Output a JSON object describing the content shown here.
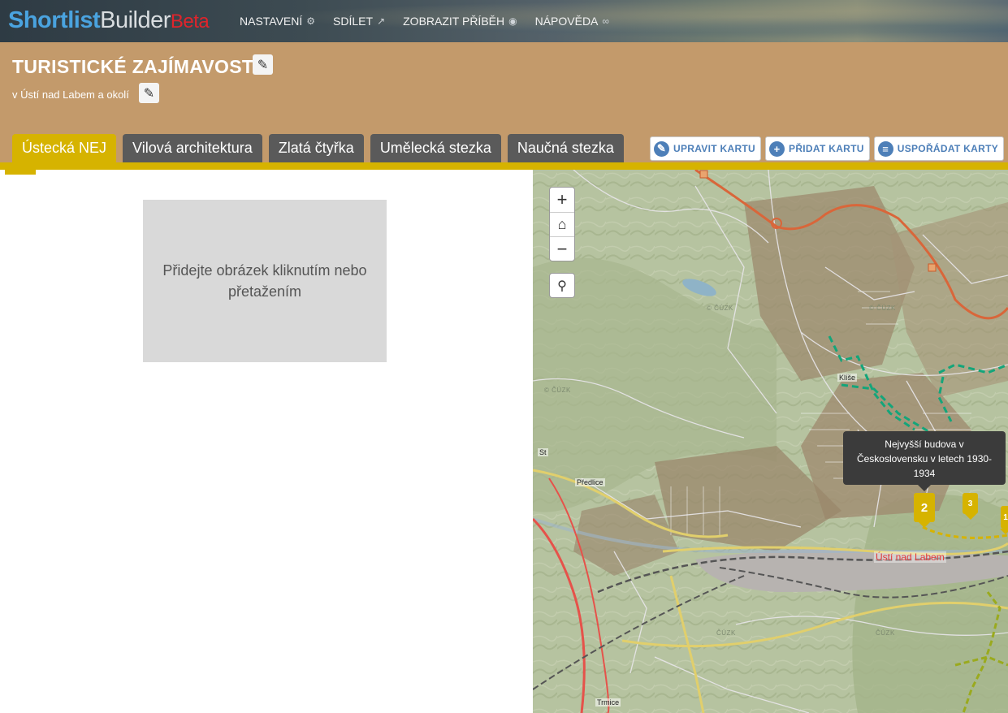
{
  "app": {
    "logo_part1": "Shortlist",
    "logo_part2": "Builder",
    "logo_badge": "Beta"
  },
  "nav": [
    {
      "label": "NASTAVENÍ",
      "icon": "gear-icon"
    },
    {
      "label": "SDÍLET",
      "icon": "share-icon"
    },
    {
      "label": "ZOBRAZIT PŘÍBĚH",
      "icon": "eye-icon"
    },
    {
      "label": "NÁPOVĚDA",
      "icon": "binoculars-icon"
    }
  ],
  "header": {
    "title": "TURISTICKÉ ZAJÍMAVOSTI",
    "subtitle": "v Ústí nad Labem a okolí"
  },
  "tabs": [
    {
      "label": "Ústecká NEJ",
      "active": true
    },
    {
      "label": "Vilová architektura",
      "active": false
    },
    {
      "label": "Zlatá čtyřka",
      "active": false
    },
    {
      "label": "Umělecká stezka",
      "active": false
    },
    {
      "label": "Naučná stezka",
      "active": false
    }
  ],
  "actions": [
    {
      "label": "UPRAVIT KARTU",
      "icon": "pencil-icon"
    },
    {
      "label": "PŘIDAT KARTU",
      "icon": "plus-icon"
    },
    {
      "label": "USPOŘÁDAT KARTY",
      "icon": "list-icon"
    }
  ],
  "panel": {
    "image_placeholder": "Přidejte obrázek kliknutím nebo přetažením"
  },
  "map": {
    "tooltip": "Nejvyšší budova v Československu v letech 1930-1934",
    "markers": [
      "2",
      "3",
      "1"
    ],
    "places": {
      "klise": "Klíše",
      "predlice": "Předlice",
      "usti": "Ústí nad Labem",
      "trmice": "Trmice",
      "st": "St"
    },
    "watermark": "© ČÚZK",
    "watermark_short": "ČÚZK"
  }
}
